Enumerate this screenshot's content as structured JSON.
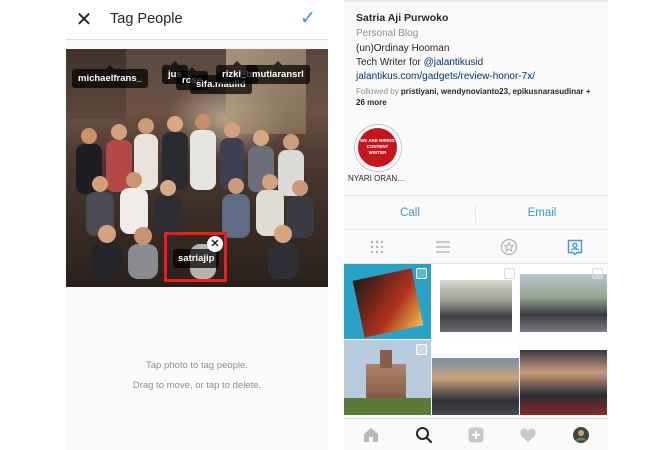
{
  "tag_people": {
    "title": "Tag People",
    "close_icon": "close-icon",
    "done_icon": "checkmark-icon",
    "tags": [
      "michaelfrans_",
      "jus",
      "rose",
      "sifa.maulid",
      "rizki_b",
      "mutiaransrl"
    ],
    "selected_tag": "satriajip",
    "hint_line1": "Tap photo to tag people.",
    "hint_line2": "Drag to move, or tap to delete.",
    "accent": "#3897f0",
    "highlight_color": "#ee1c1c"
  },
  "profile": {
    "name": "Satria Aji Purwoko",
    "category": "Personal Blog",
    "bio_line1": "(un)Ordinay Hooman",
    "bio_line2_prefix": "Tech Writer for ",
    "bio_line2_mention": "@jalantikusid",
    "link": "jalantikus.com/gadgets/review-honor-7x/",
    "followed_by_prefix": "Followed by ",
    "followed_by_names": "pristiyani, wendynovianto23, epikusnarasudinar",
    "followed_by_more": "+ 26 more",
    "highlight_label": "NYARI ORAN…",
    "highlight_cover_text": "WE ARE HIRING CONTENT WRITER",
    "call_label": "Call",
    "email_label": "Email",
    "view_tabs": [
      "grid-icon",
      "list-icon",
      "tagged-star-icon",
      "tagged-person-icon"
    ],
    "active_tab": "tagged-person-icon"
  },
  "bottom_nav": [
    "home-icon",
    "search-icon",
    "add-icon",
    "heart-icon",
    "profile-avatar"
  ]
}
